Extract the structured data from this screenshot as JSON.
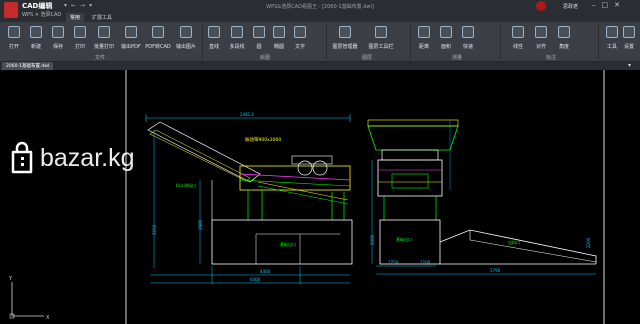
{
  "app": {
    "brand_title": "CAD编辑",
    "brand_subtitle": "WPS × 浩辰CAD",
    "window_title": "WPS&浩辰CAD看图王 - [2060-1基础布置.dwl]",
    "user_name": "思政老"
  },
  "tabs": [
    {
      "label": "常用",
      "active": true
    },
    {
      "label": "扩展工具",
      "active": false
    }
  ],
  "ribbon": {
    "groups": [
      {
        "label": "文件"
      },
      {
        "label": "绘图"
      },
      {
        "label": "图层"
      },
      {
        "label": "测量"
      },
      {
        "label": "标注"
      }
    ],
    "tools": [
      {
        "label": "打开",
        "icon": "folder-icon"
      },
      {
        "label": "新建",
        "icon": "new-file-icon"
      },
      {
        "label": "保存",
        "icon": "save-icon"
      },
      {
        "label": "打印",
        "icon": "print-icon"
      },
      {
        "label": "批量打印",
        "icon": "batch-print-icon"
      },
      {
        "label": "输出PDF",
        "icon": "pdf-icon"
      },
      {
        "label": "PDF转CAD",
        "icon": "pdf-convert-icon"
      },
      {
        "label": "输出图片",
        "icon": "image-export-icon"
      },
      {
        "label": "直线",
        "icon": "line-icon"
      },
      {
        "label": "多段线",
        "icon": "polyline-icon"
      },
      {
        "label": "圆",
        "icon": "circle-icon"
      },
      {
        "label": "椭圆",
        "icon": "ellipse-icon"
      },
      {
        "label": "文字",
        "icon": "text-icon"
      },
      {
        "label": "图层管理器",
        "icon": "layer-manager-icon"
      },
      {
        "label": "图层工具栏",
        "icon": "layer-toolbar-icon"
      },
      {
        "label": "距离",
        "icon": "distance-icon"
      },
      {
        "label": "面积",
        "icon": "area-icon"
      },
      {
        "label": "快速",
        "icon": "quick-measure-icon"
      },
      {
        "label": "线性",
        "icon": "linear-dim-icon"
      },
      {
        "label": "对齐",
        "icon": "aligned-dim-icon"
      },
      {
        "label": "角度",
        "icon": "angle-dim-icon"
      },
      {
        "label": "工具",
        "icon": "tools-icon"
      },
      {
        "label": "设置",
        "icon": "settings-icon"
      }
    ]
  },
  "document_tab": "2060-1基础布置.dwl",
  "drawing": {
    "dims_left": [
      "2481.2",
      "2200",
      "2980",
      "4460",
      "6400"
    ],
    "dims_right": [
      "1750",
      "1200",
      "2000",
      "5790",
      "2200"
    ],
    "labels_left": [
      "振动筛900x3000",
      "料斗进料口",
      "基础出口"
    ],
    "labels_right": [
      "基础出口",
      "出料口"
    ]
  },
  "watermark": "bazar.kg",
  "colors": {
    "background": "#000000",
    "ribbon": "#3b3f45",
    "cad_cyan": "#00c8ff",
    "cad_yellow": "#ffff00",
    "cad_green": "#00ff00",
    "cad_white": "#ffffff",
    "cad_magenta": "#ff40ff"
  }
}
